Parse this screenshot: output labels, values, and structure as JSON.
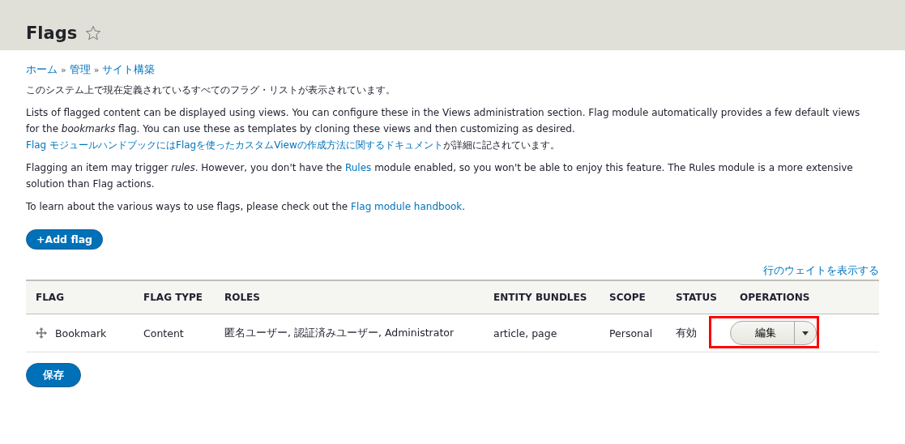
{
  "page_title": "Flags",
  "favorite": {
    "on": false
  },
  "breadcrumb": [
    "ホーム",
    "管理",
    "サイト構築"
  ],
  "breadcrumb_separator": "»",
  "paragraphs": [
    [
      {
        "kind": "text",
        "text": "このシステム上で現在定義されているすべてのフラグ・リストが表示されています。"
      }
    ],
    [
      {
        "kind": "text",
        "text": "Lists of flagged content can be displayed using views. You can configure these in the Views administration section. Flag module automatically provides a few default views for the *bookmarks* flag. You can use these as templates by cloning these views and then customizing as desired. "
      },
      {
        "kind": "link",
        "text": "Flag モジュールハンドブックにはFlagを使ったカスタムViewの作成方法に関するドキュメント"
      },
      {
        "kind": "text",
        "text": "が詳細に記されています。"
      }
    ],
    [
      {
        "kind": "text",
        "text": "Flagging an item may trigger *rules*. However, you don't have the "
      },
      {
        "kind": "link",
        "text": "Rules"
      },
      {
        "kind": "text",
        "text": " module enabled, so you won't be able to enjoy this feature. The Rules module is a more extensive solution than Flag actions."
      }
    ],
    [
      {
        "kind": "text",
        "text": "To learn about the various ways to use flags, please check out the "
      },
      {
        "kind": "link",
        "text": "Flag module handbook"
      },
      {
        "kind": "text",
        "text": "."
      }
    ]
  ],
  "add_button": {
    "icon": "+",
    "label": "Add flag"
  },
  "weights_link": "行のウェイトを表示する",
  "table": {
    "columns": [
      "FLAG",
      "FLAG TYPE",
      "ROLES",
      "ENTITY BUNDLES",
      "SCOPE",
      "STATUS",
      "OPERATIONS"
    ],
    "rows": [
      {
        "flag": "Bookmark",
        "flag_type": "Content",
        "roles": "匿名ユーザー, 認証済みユーザー, Administrator",
        "entity_bundles": "article, page",
        "scope": "Personal",
        "status": "有効",
        "operation": "編集",
        "highlighted": true
      }
    ]
  },
  "save_button": "保存"
}
